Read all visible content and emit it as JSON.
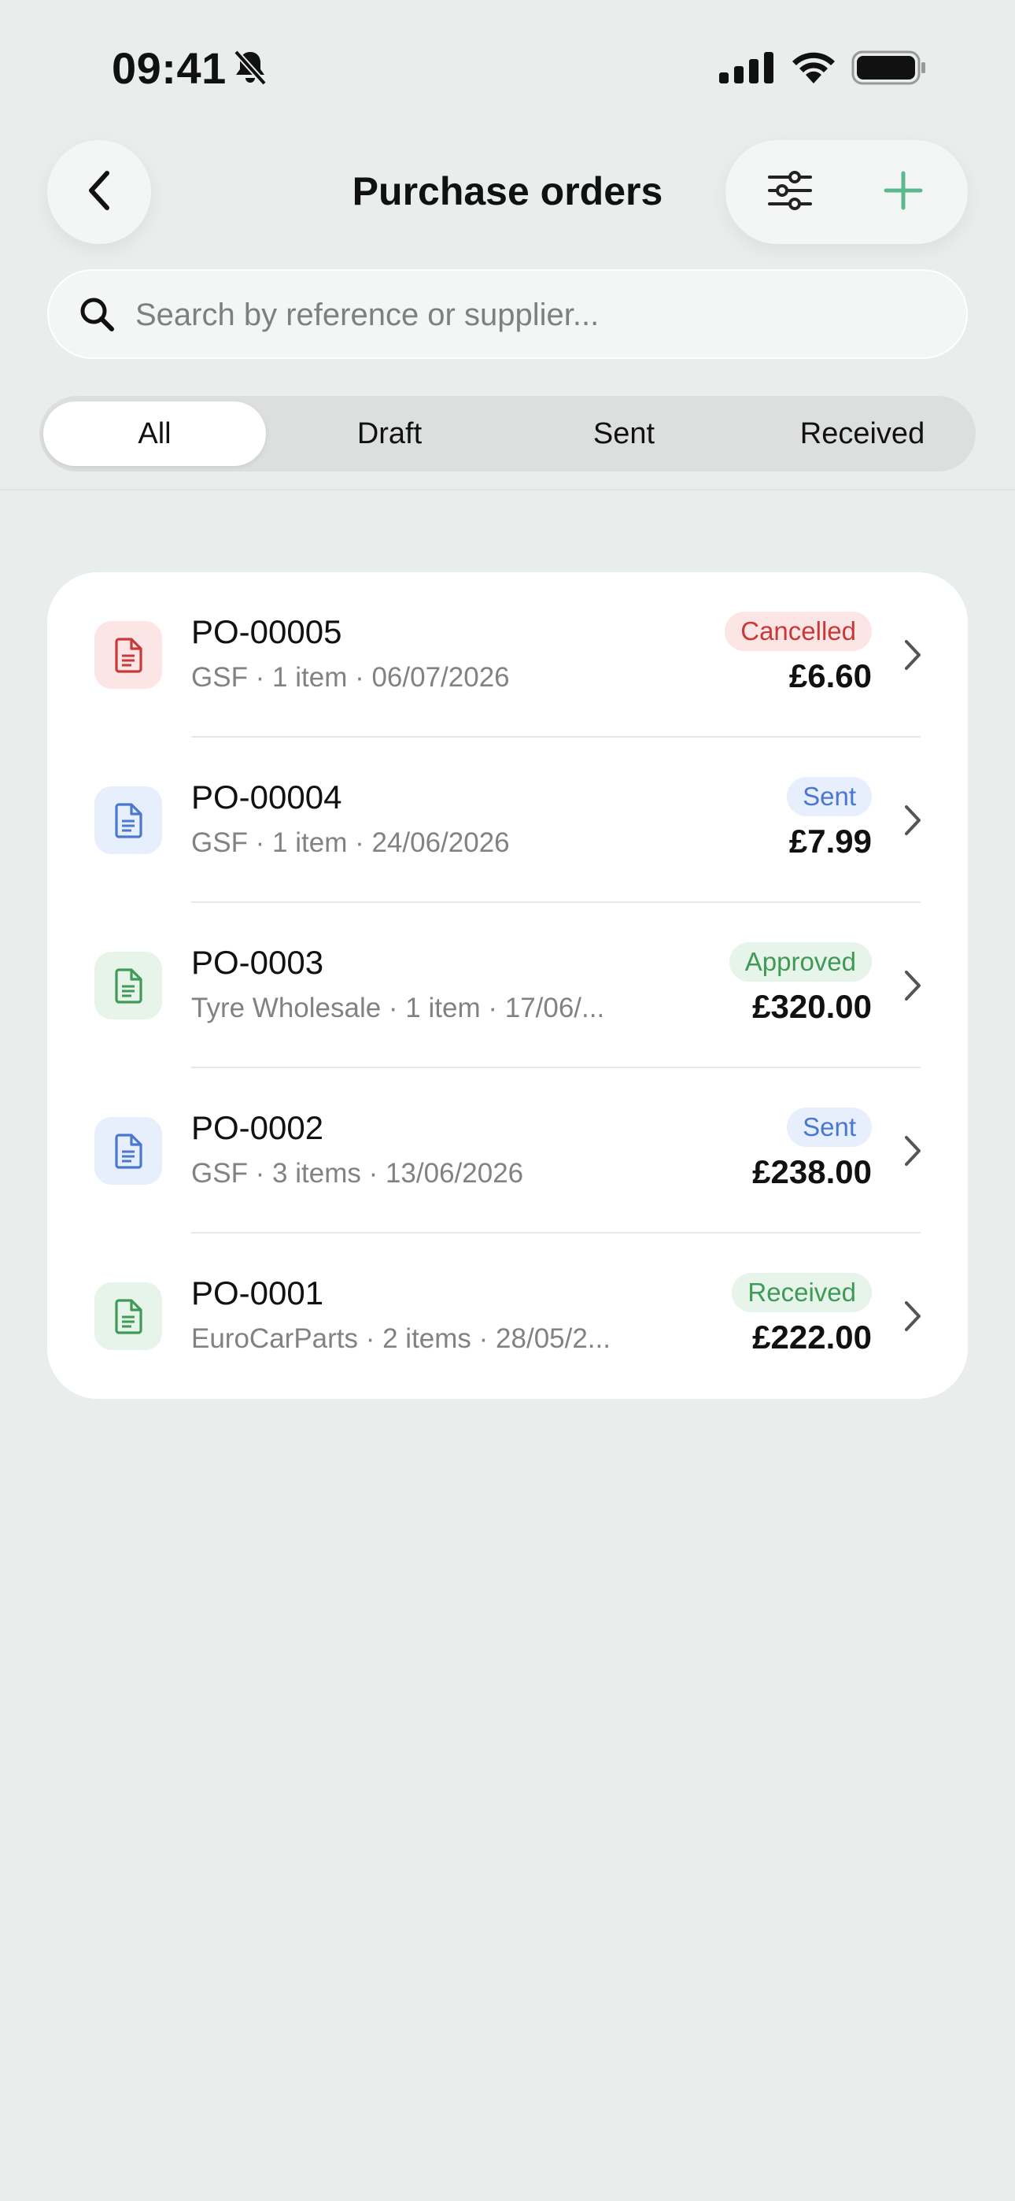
{
  "status_bar": {
    "time": "09:41"
  },
  "header": {
    "title": "Purchase orders",
    "back_icon": "chevron-left-icon",
    "filter_icon": "sliders-icon",
    "add_icon": "plus-icon"
  },
  "search": {
    "placeholder": "Search by reference or supplier...",
    "value": ""
  },
  "tabs": [
    {
      "label": "All",
      "active": true
    },
    {
      "label": "Draft",
      "active": false
    },
    {
      "label": "Sent",
      "active": false
    },
    {
      "label": "Received",
      "active": false
    }
  ],
  "colors": {
    "accent": "#5cb88f",
    "cancelled": {
      "text": "#c9393a",
      "bg": "#fbe5e5"
    },
    "sent": {
      "text": "#4a78d1",
      "bg": "#e7eefc"
    },
    "approved": {
      "text": "#3f9a57",
      "bg": "#e6f4ea"
    },
    "received": {
      "text": "#3f9a57",
      "bg": "#e6f4ea"
    }
  },
  "orders": [
    {
      "ref": "PO-00005",
      "meta": "GSF · 1 item · 06/07/2026",
      "status": "Cancelled",
      "status_key": "cancelled",
      "amount": "£6.60"
    },
    {
      "ref": "PO-00004",
      "meta": "GSF · 1 item · 24/06/2026",
      "status": "Sent",
      "status_key": "sent",
      "amount": "£7.99"
    },
    {
      "ref": "PO-0003",
      "meta": "Tyre Wholesale · 1 item · 17/06/...",
      "status": "Approved",
      "status_key": "approved",
      "amount": "£320.00"
    },
    {
      "ref": "PO-0002",
      "meta": "GSF · 3 items · 13/06/2026",
      "status": "Sent",
      "status_key": "sent",
      "amount": "£238.00"
    },
    {
      "ref": "PO-0001",
      "meta": "EuroCarParts · 2 items · 28/05/2...",
      "status": "Received",
      "status_key": "received",
      "amount": "£222.00"
    }
  ]
}
